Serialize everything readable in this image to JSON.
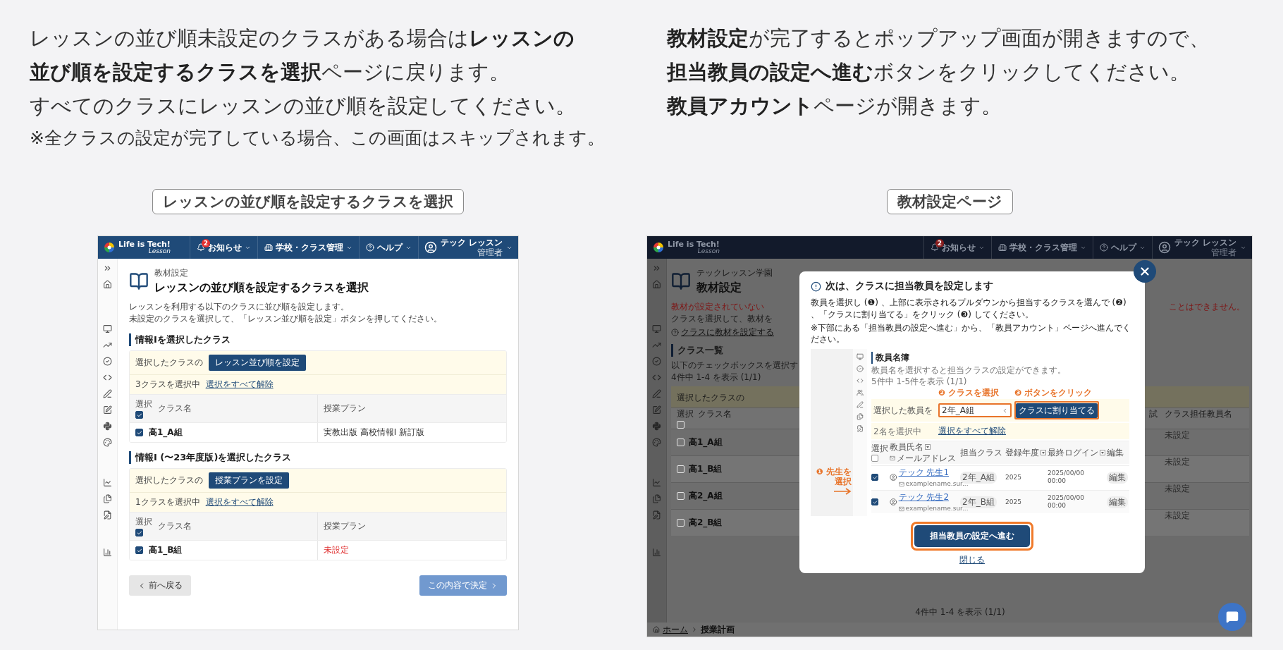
{
  "intro": {
    "left": [
      {
        "kind": "main",
        "text": "レッスンの並び順未設定のクラスがある場合は**レッスンの並び順を設定するクラスを選択**ページに戻ります。"
      },
      {
        "kind": "main",
        "text": "すべてのクラスにレッスンの並び順を設定してください。"
      },
      {
        "kind": "note",
        "text": "※全クラスの設定が完了している場合、この画面はスキップされます。"
      }
    ],
    "right": [
      {
        "kind": "main",
        "text": "**教材設定**が完了するとポップアップ画面が開きますので、"
      },
      {
        "kind": "main",
        "text": "**担当教員の設定へ進む**ボタンをクリックしてください。"
      },
      {
        "kind": "main",
        "text": "**教員アカウント**ページが開きます。"
      }
    ]
  },
  "left_screen": {
    "caption": "レッスンの並び順を設定するクラスを選択",
    "header": {
      "logo": "Life is Tech!",
      "logo_sub": "Lesson",
      "notice_count": "2",
      "menus": [
        {
          "kind": "notice",
          "label": "お知らせ"
        },
        {
          "kind": "school",
          "label": "学校・クラス管理"
        },
        {
          "kind": "help",
          "label": "ヘルプ"
        }
      ],
      "user": "テック レッスン",
      "role": "管理者"
    },
    "page_label": "教材設定",
    "page_title": "レッスンの並び順を設定するクラスを選択",
    "description": [
      "レッスンを利用する以下のクラスに並び順を設定します。",
      "未設定のクラスを選択して、「レッスン並び順を設定」ボタンを押してください。"
    ],
    "sections": [
      {
        "title": "情報Iを選択したクラス",
        "bar_label": "選択したクラスの",
        "action": "レッスン並び順を設定",
        "count": "3クラスを選択中",
        "clear": "選択をすべて解除",
        "columns": {
          "select": "選択",
          "name": "クラス名",
          "plan": "授業プラン"
        },
        "all_checked": true,
        "rows": [
          {
            "name": "高1_A組",
            "checked": true,
            "plan": "実教出版 高校情報I 新訂版",
            "kind": "set"
          }
        ]
      },
      {
        "title": "情報I (〜23年度版)を選択したクラス",
        "bar_label": "選択したクラスの",
        "action": "授業プランを設定",
        "count": "1クラスを選択中",
        "clear": "選択をすべて解除",
        "columns": {
          "select": "選択",
          "name": "クラス名",
          "plan": "授業プラン"
        },
        "all_checked": true,
        "rows": [
          {
            "name": "高1_B組",
            "checked": true,
            "plan": "未設定",
            "kind": "unset"
          }
        ]
      }
    ],
    "back": "前へ戻る",
    "submit": {
      "label": "この内容で決定",
      "disabled": true
    }
  },
  "right_screen": {
    "caption": "教材設定ページ",
    "header": {
      "logo": "Life is Tech!",
      "logo_sub": "Lesson",
      "notice_count": "2",
      "menus": [
        {
          "kind": "notice",
          "label": "お知らせ"
        },
        {
          "kind": "school",
          "label": "学校・クラス管理"
        },
        {
          "kind": "help",
          "label": "ヘルプ"
        }
      ],
      "user": "テック レッスン",
      "role": "管理者"
    },
    "page_label": "テックレッスン学園",
    "page_title": "教材設定",
    "warning": [
      "教材が設定されていない",
      "ことはできません。"
    ],
    "instruction": "クラスを選択して、教材を",
    "help_link": "クラスに教材を設定する",
    "section_title": "クラス一覧",
    "list_note": "以下のチェックボックスを選択す",
    "count_top": "4件中 1-4 を表示 (1/1)",
    "bar_label": "選択したクラスの",
    "columns": {
      "select": "選択",
      "name": "クラス名",
      "column_3": "試",
      "teacher": "クラス担任教員名"
    },
    "all_checked": false,
    "rows": [
      {
        "name": "高1_A組",
        "checked": false,
        "teacher": "未設定"
      },
      {
        "name": "高1_B組",
        "checked": false,
        "teacher": "未設定"
      },
      {
        "name": "高2_A組",
        "checked": false,
        "teacher": "未設定"
      },
      {
        "name": "高2_B組",
        "checked": false,
        "teacher": "未設定"
      }
    ],
    "count_bottom": "4件中 1-4 を表示 (1/1)",
    "breadcrumb": [
      {
        "kind": "link",
        "label": "ホーム"
      },
      {
        "kind": "current",
        "label": "授業計画"
      }
    ],
    "modal": {
      "title": "次は、クラスに担当教員を設定します",
      "body": "教員を選択し (❶) 、上部に表示されるプルダウンから担当するクラスを選んで (❷) 、「クラスに割り当てる」をクリック (❸) してください。",
      "note": "※下部にある「担当教員の設定へ進む」から、「教員アカウント」ページへ進んでください。",
      "example": {
        "title": "教員名簿",
        "description": "教員名を選択すると担当クラスの設定ができます。",
        "count": "5件中 1-5件を表示 (1/1)",
        "callouts": [
          {
            "number": "❶",
            "text": "先生を選択"
          },
          {
            "number": "❷",
            "text": "クラスを選択"
          },
          {
            "number": "❸",
            "text": "ボタンをクリック"
          }
        ],
        "select_label": "選択した教員を",
        "dropdown_value": "2年_A組",
        "assign": "クラスに割り当てる",
        "selected_count": "2名を選択中",
        "clear": "選択をすべて解除",
        "columns": {
          "select": "選択",
          "name": "教員氏名",
          "email": "メールアドレス",
          "class": "担当クラス",
          "year": "登録年度",
          "login": "最終ログイン",
          "edit": "編集"
        },
        "all_checked": false,
        "rows": [
          {
            "name": "テック 先生1",
            "email": "examplename.sur...",
            "class": "2年_A組",
            "year": "2025",
            "login": "2025/00/00 00:00",
            "edit": "編集",
            "checked": true
          },
          {
            "name": "テック 先生2",
            "email": "examplename.sur...",
            "class": "2年_B組",
            "year": "2025",
            "login": "2025/00/00 00:00",
            "edit": "編集",
            "checked": true
          }
        ]
      },
      "primary": "担当教員の設定へ進む",
      "close_link": "閉じる"
    }
  }
}
